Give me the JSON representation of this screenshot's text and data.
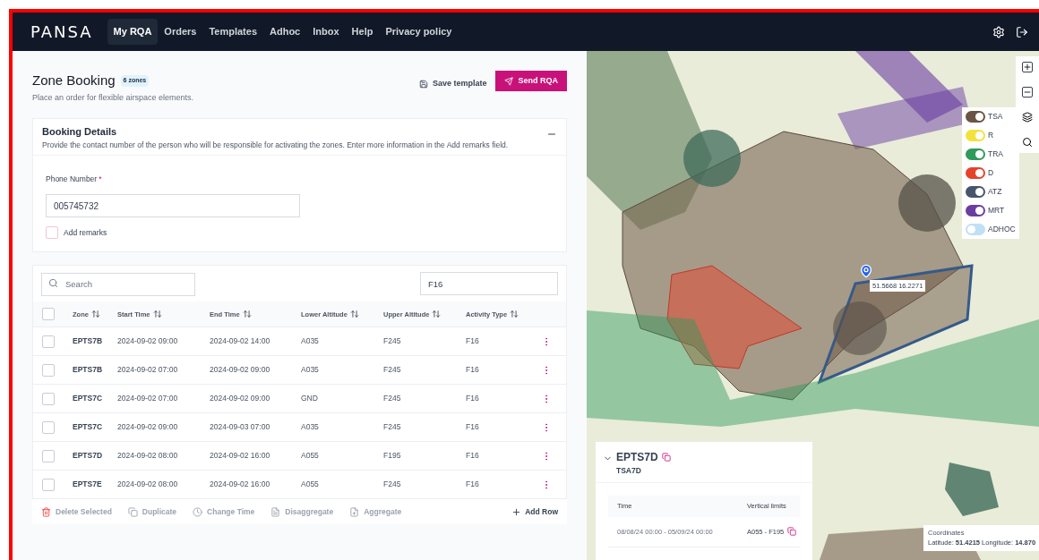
{
  "nav": {
    "logo": "PANSA",
    "items": [
      {
        "label": "My RQA",
        "selected": true
      },
      {
        "label": "Orders",
        "selected": false
      },
      {
        "label": "Templates",
        "selected": false
      },
      {
        "label": "Adhoc",
        "selected": false
      },
      {
        "label": "Inbox",
        "selected": false
      },
      {
        "label": "Help",
        "selected": false
      },
      {
        "label": "Privacy policy",
        "selected": false
      }
    ]
  },
  "header": {
    "title": "Zone Booking",
    "badge": "6 zones",
    "subtitle": "Place an order for flexible airspace elements.",
    "save_template": "Save template",
    "send": "Send RQA"
  },
  "booking_details": {
    "title": "Booking Details",
    "description": "Provide the contact number of the person who will be responsible for activating the zones. Enter more information in the Add remarks field.",
    "expanded": true,
    "phone_label": "Phone Number",
    "phone_required": "*",
    "phone_value": "005745732",
    "remarks_label": "Add remarks",
    "remarks_checked": false
  },
  "table": {
    "search_placeholder": "Search",
    "filter_value": "F16",
    "all_checked": false,
    "columns": [
      "Zone",
      "Start Time",
      "End Time",
      "Lower Altitude",
      "Upper Altitude",
      "Activity Type"
    ],
    "rows": [
      {
        "checked": false,
        "cells": [
          "EPTS7B",
          "2024-09-02 09:00",
          "2024-09-02 14:00",
          "A035",
          "F245",
          "F16"
        ]
      },
      {
        "checked": false,
        "cells": [
          "EPTS7B",
          "2024-09-02 07:00",
          "2024-09-02 09:00",
          "A035",
          "F245",
          "F16"
        ]
      },
      {
        "checked": false,
        "cells": [
          "EPTS7C",
          "2024-09-02 07:00",
          "2024-09-02 09:00",
          "GND",
          "F245",
          "F16"
        ]
      },
      {
        "checked": false,
        "cells": [
          "EPTS7C",
          "2024-09-02 09:00",
          "2024-09-03 07:00",
          "A035",
          "F245",
          "F16"
        ]
      },
      {
        "checked": false,
        "cells": [
          "EPTS7D",
          "2024-09-02 08:00",
          "2024-09-02 16:00",
          "A055",
          "F195",
          "F16"
        ]
      },
      {
        "checked": false,
        "cells": [
          "EPTS7E",
          "2024-09-02 08:00",
          "2024-09-02 16:00",
          "A055",
          "F245",
          "F16"
        ]
      }
    ]
  },
  "actions": [
    {
      "kind": "delete",
      "label": "Delete Selected"
    },
    {
      "kind": "duplicate",
      "label": "Duplicate"
    },
    {
      "kind": "time",
      "label": "Change Time"
    },
    {
      "kind": "disaggregate",
      "label": "Disaggregate"
    },
    {
      "kind": "aggregate",
      "label": "Aggregate"
    }
  ],
  "add_row": "Add Row",
  "map": {
    "pin_label": "51.5668 16.2271",
    "legend": [
      {
        "label": "TSA",
        "on": true,
        "color": "#6b5444"
      },
      {
        "label": "R",
        "on": true,
        "color": "#f2e33c"
      },
      {
        "label": "TRA",
        "on": true,
        "color": "#2f9a5a"
      },
      {
        "label": "D",
        "on": true,
        "color": "#e5432b"
      },
      {
        "label": "ATZ",
        "on": true,
        "color": "#465569"
      },
      {
        "label": "MRT",
        "on": true,
        "color": "#6a3ea1"
      },
      {
        "label": "ADHOC",
        "on": false,
        "color": "#bfe0f5"
      }
    ],
    "popup": {
      "expanded": true,
      "title": "EPTS7D",
      "subtitle": "TSA7D",
      "columns": [
        "Time",
        "Vertical limits"
      ],
      "row": [
        "08/08/24 00:00 - 05/09/24 00:00",
        "A055 - F195"
      ]
    },
    "coordinates": {
      "title": "Coordinates",
      "text": "Latitude: **51.4215** Longitude: **14.870**"
    }
  }
}
